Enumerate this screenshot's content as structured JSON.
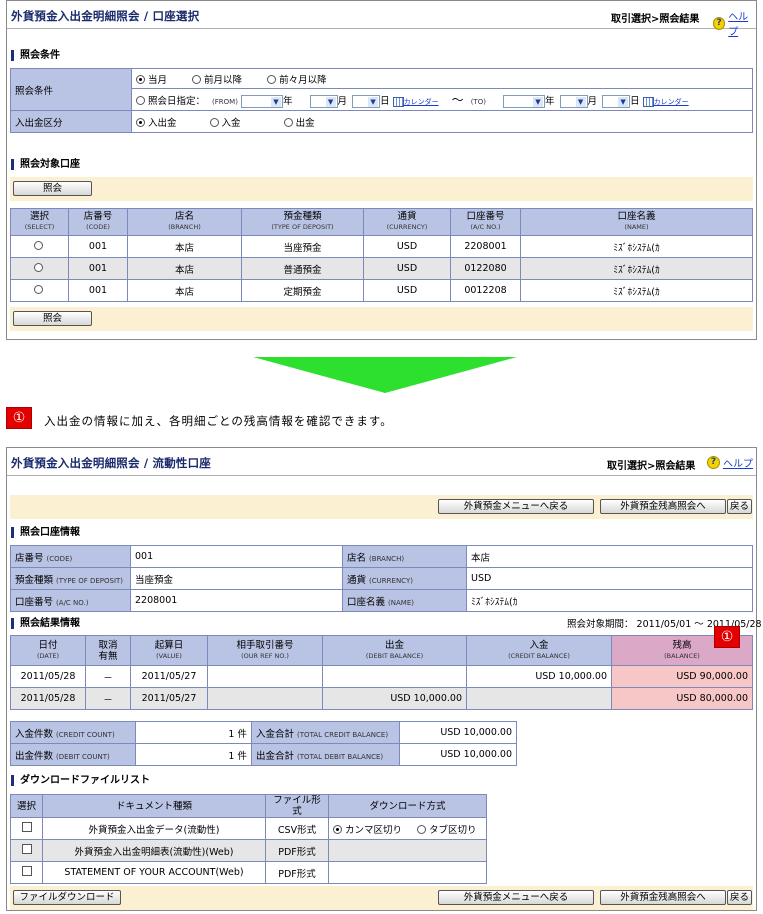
{
  "panel1": {
    "title": "外貨預金入出金明細照会 / 口座選択",
    "breadcrumb": "取引選択>照会結果",
    "help": "ヘルプ",
    "section_conditions": "照会条件",
    "cond_label": "照会条件",
    "cond_options": [
      "当月",
      "前月以降",
      "前々月以降"
    ],
    "date_option": "照会日指定：",
    "from_label": "(FROM)",
    "to_label": "(TO)",
    "year": "年",
    "month": "月",
    "day": "日",
    "calendar": "カレンダー",
    "tilde": "～",
    "type_label": "入出金区分",
    "type_options": [
      "入出金",
      "入金",
      "出金"
    ],
    "section_accounts": "照会対象口座",
    "query_button": "照会",
    "columns": [
      {
        "ja": "選択",
        "en": "(SELECT)"
      },
      {
        "ja": "店番号",
        "en": "(CODE)"
      },
      {
        "ja": "店名",
        "en": "(BRANCH)"
      },
      {
        "ja": "預金種類",
        "en": "(TYPE OF DEPOSIT)"
      },
      {
        "ja": "通貨",
        "en": "(CURRENCY)"
      },
      {
        "ja": "口座番号",
        "en": "(A/C NO.)"
      },
      {
        "ja": "口座名義",
        "en": "(NAME)"
      }
    ],
    "rows": [
      {
        "code": "001",
        "branch": "本店",
        "type": "当座預金",
        "currency": "USD",
        "acno": "2208001",
        "name": "ﾐｽﾞﾎｼｽﾃﾑ(ｶ"
      },
      {
        "code": "001",
        "branch": "本店",
        "type": "普通預金",
        "currency": "USD",
        "acno": "0122080",
        "name": "ﾐｽﾞﾎｼｽﾃﾑ(ｶ"
      },
      {
        "code": "001",
        "branch": "本店",
        "type": "定期預金",
        "currency": "USD",
        "acno": "0012208",
        "name": "ﾐｽﾞﾎｼｽﾃﾑ(ｶ"
      }
    ]
  },
  "callout": {
    "marker": "①",
    "text": "入出金の情報に加え、各明細ごとの残高情報を確認できます。"
  },
  "panel2": {
    "title": "外貨預金入出金明細照会 / 流動性口座",
    "breadcrumb": "取引選択>照会結果",
    "help": "ヘルプ",
    "btn_menu": "外貨預金メニューへ戻る",
    "btn_balance": "外貨預金残高照会へ",
    "btn_back": "戻る",
    "section_account": "照会口座情報",
    "info": {
      "code_label": "店番号",
      "code_en": "(CODE)",
      "code": "001",
      "branch_label": "店名",
      "branch_en": "(BRANCH)",
      "branch": "本店",
      "type_label": "預金種類",
      "type_en": "(TYPE OF DEPOSIT)",
      "type": "当座預金",
      "currency_label": "通貨",
      "currency_en": "(CURRENCY)",
      "currency": "USD",
      "acno_label": "口座番号",
      "acno_en": "(A/C NO.)",
      "acno": "2208001",
      "name_label": "口座名義",
      "name_en": "(NAME)",
      "name": "ﾐｽﾞﾎｼｽﾃﾑ(ｶ"
    },
    "section_result": "照会結果情報",
    "period": "照会対象期間： 2011/05/01 ～ 2011/05/28",
    "columns": [
      {
        "ja": "日付",
        "en": "(DATE)"
      },
      {
        "ja": "取消\n有無",
        "en": ""
      },
      {
        "ja": "起算日",
        "en": "(VALUE)"
      },
      {
        "ja": "相手取引番号",
        "en": "(OUR REF NO.)"
      },
      {
        "ja": "出金",
        "en": "(DEBIT BALANCE)"
      },
      {
        "ja": "入金",
        "en": "(CREDIT BALANCE)"
      },
      {
        "ja": "残高",
        "en": "(BALANCE)"
      }
    ],
    "rows": [
      {
        "date": "2011/05/28",
        "cancel": "－",
        "value": "2011/05/27",
        "ref": "",
        "debit": "",
        "credit": "USD 10,000.00",
        "balance": "USD 90,000.00"
      },
      {
        "date": "2011/05/28",
        "cancel": "－",
        "value": "2011/05/27",
        "ref": "",
        "debit": "USD 10,000.00",
        "credit": "",
        "balance": "USD 80,000.00"
      }
    ],
    "totals": {
      "credit_count_label": "入金件数",
      "credit_count_en": "(CREDIT COUNT)",
      "credit_count": "1 件",
      "credit_total_label": "入金合計",
      "credit_total_en": "(TOTAL CREDIT BALANCE)",
      "credit_total": "USD 10,000.00",
      "debit_count_label": "出金件数",
      "debit_count_en": "(DEBIT COUNT)",
      "debit_count": "1 件",
      "debit_total_label": "出金合計",
      "debit_total_en": "(TOTAL DEBIT BALANCE)",
      "debit_total": "USD 10,000.00"
    },
    "section_download": "ダウンロードファイルリスト",
    "dl_columns": [
      "選択",
      "ドキュメント種類",
      "ファイル形式",
      "ダウンロード方式"
    ],
    "dl_rows": [
      {
        "doc": "外貨預金入出金データ(流動性)",
        "format": "CSV形式"
      },
      {
        "doc": "外貨預金入出金明細表(流動性)(Web)",
        "format": "PDF形式"
      },
      {
        "doc": "STATEMENT OF YOUR ACCOUNT(Web)",
        "format": "PDF形式"
      }
    ],
    "dl_methods": [
      "カンマ区切り",
      "タブ区切り"
    ],
    "btn_download": "ファイルダウンロード"
  }
}
